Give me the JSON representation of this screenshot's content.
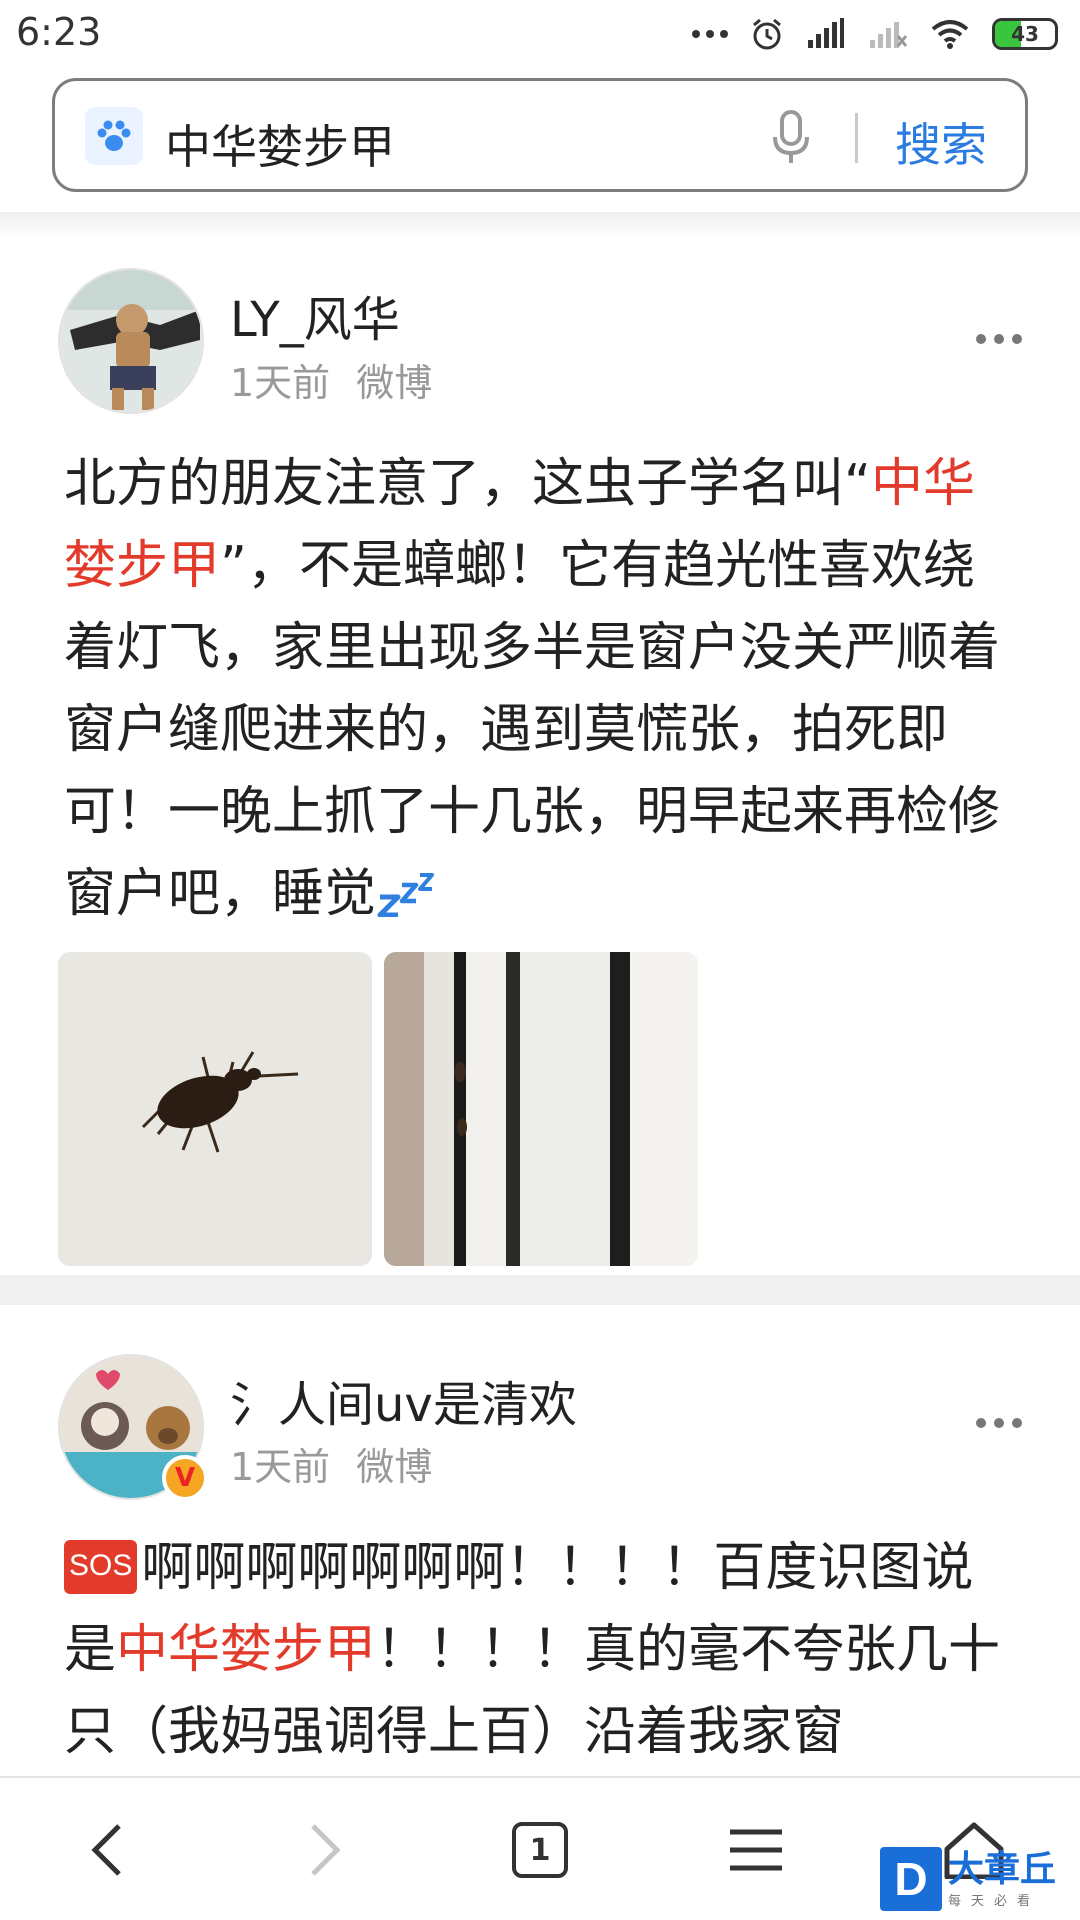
{
  "status_bar": {
    "time": "6:23",
    "battery": "43"
  },
  "search": {
    "query": "中华婪步甲",
    "button_label": "搜索"
  },
  "posts": [
    {
      "username": "LY_风华",
      "time": "1天前",
      "source": "微博",
      "content": {
        "part1": "北方的朋友注意了，这虫子学名叫“",
        "highlight": "中华婪步甲",
        "part2": "”，不是蟑螂！它有趋光性喜欢绕着灯飞，家里出现多半是窗户没关严顺着窗户缝爬进来的，遇到莫慌张，拍死即可！一晚上抓了十几张，明早起来再检修窗户吧，睡觉"
      },
      "images": [
        "beetle photo",
        "window gap photo"
      ]
    },
    {
      "username": "氵人间uv是清欢",
      "time": "1天前",
      "source": "微博",
      "verified_label": "V",
      "content": {
        "emoji_label": "SOS",
        "part1": "啊啊啊啊啊啊啊！！！！百度识图说是",
        "highlight": "中华婪步甲",
        "part2": "！！！！真的毫不夸张几十只（我妈强调得上百）沿着我家窗"
      }
    }
  ],
  "bottom_nav": {
    "tab_count": "1"
  },
  "watermark": {
    "logo_letter": "D",
    "title": "大章丘",
    "subtitle": "每天必看"
  },
  "colors": {
    "highlight": "#e33b2b",
    "search_button": "#2a7ce0",
    "battery_fill": "#39c53e"
  }
}
